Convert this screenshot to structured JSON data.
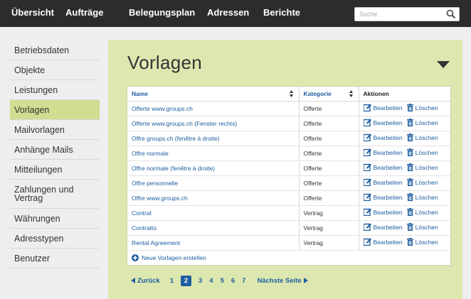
{
  "nav": {
    "items": [
      "Übersicht",
      "Aufträge",
      "Belegungsplan",
      "Adressen",
      "Berichte"
    ],
    "search_placeholder": "Suche"
  },
  "sidebar": {
    "items": [
      {
        "label": "Betriebsdaten"
      },
      {
        "label": "Objekte"
      },
      {
        "label": "Leistungen"
      },
      {
        "label": "Vorlagen",
        "active": true
      },
      {
        "label": "Mailvorlagen"
      },
      {
        "label": "Anhänge Mails"
      },
      {
        "label": "Mitteilungen"
      },
      {
        "label": "Zahlungen und Vertrag"
      },
      {
        "label": "Währungen"
      },
      {
        "label": "Adresstypen"
      },
      {
        "label": "Benutzer"
      }
    ]
  },
  "main": {
    "title": "Vorlagen",
    "table": {
      "headers": {
        "name": "Name",
        "category": "Kategorie",
        "actions": "Aktionen"
      },
      "edit_label": "Bearbeiten",
      "delete_label": "Löschen",
      "rows": [
        {
          "name": "Offerte www.groups.ch",
          "category": "Offerte"
        },
        {
          "name": "Offerte www.groups.ch (Fenster rechts)",
          "category": "Offerte"
        },
        {
          "name": "Offre groups.ch (fenêtre à droite)",
          "category": "Offerte"
        },
        {
          "name": "Offre normale",
          "category": "Offerte"
        },
        {
          "name": "Offre normale (fenêtre à droite)",
          "category": "Offerte"
        },
        {
          "name": "Offre personnelle",
          "category": "Offerte"
        },
        {
          "name": "Offre www.groups.ch",
          "category": "Offerte"
        },
        {
          "name": "Contrat",
          "category": "Vertrag"
        },
        {
          "name": "Contratto",
          "category": "Vertrag"
        },
        {
          "name": "Rental Agreement",
          "category": "Vertrag"
        }
      ],
      "new_label": "Neue Vorlagen erstellen"
    },
    "pager": {
      "prev_label": "Zurück",
      "next_label": "Nächste Seite",
      "pages": [
        "1",
        "2",
        "3",
        "4",
        "5",
        "6",
        "7"
      ],
      "current": "2"
    }
  },
  "colors": {
    "nav_bg": "#2c2c2c",
    "main_bg": "#dde8b0",
    "active_sidebar": "#cfde90",
    "link": "#1c5d9f"
  }
}
